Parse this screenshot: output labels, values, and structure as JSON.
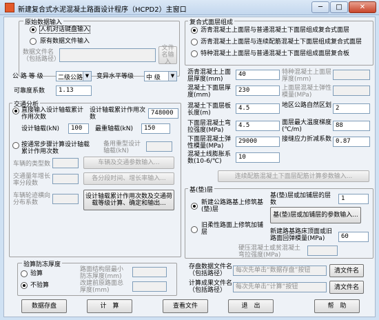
{
  "window": {
    "title": "新建复合式水泥混凝土路面设计程序（HCPD2）主窗口",
    "min": "─",
    "max": "□",
    "close": "✕"
  },
  "source": {
    "legend": "原始数据输入",
    "opt_manual": "人机对话键盘输入",
    "opt_file": "原有数据文件输入",
    "file_label": "数据文件名（包括路径）",
    "file_button": "文件名输入"
  },
  "road": {
    "grade_label": "公 路 等 级",
    "grade_value": "二级公路",
    "variability_label": "变异水平等级",
    "variability_value": "中 级",
    "reliability_label": "可靠度系数",
    "reliability_value": "1.13"
  },
  "traffic": {
    "legend": "交通分析",
    "opt_direct": "直接输入设计轴载累计作用次数",
    "cumulative_label": "设计轴载累计作用次数",
    "cumulative_value": "748000",
    "design_axle_label": "设计轴载(kN)",
    "design_axle_value": "100",
    "max_axle_label": "最重轴载(kN)",
    "max_axle_value": "150",
    "opt_calc": "按通常步骤计算设计轴载累计作用次数",
    "alt_axle_label": "备用重型设计轴载(kN)",
    "vehicle_types_label": "车辆的类型数",
    "vehicle_button": "车辆及交通参数输入...",
    "growth_label": "交通量年增长率分段数",
    "growth_button": "各分段时间、增长率输入...",
    "lateral_label": "车辆轮迹横向分布系数",
    "result_button": "设计轴载累计作用次数及交通荷载等级计算、确定和输出..."
  },
  "prevention": {
    "legend": "验算防冻厚度",
    "opt_check": "验算",
    "opt_nocheck": "不验算",
    "min_label": "路面结构层最小防冻厚度(mm)",
    "new_label": "改建前原路面总厚度(mm)"
  },
  "structure": {
    "legend": "复合式面层组成",
    "opt1": "沥青混凝土上面层与普通混凝土下面层组成复合式面层",
    "opt2": "沥青混凝土上面层与连续配筋混凝土下面层组成复合式面层",
    "opt3": "特种混凝土上面层与普通混凝土下面层组成面层复合板"
  },
  "params": {
    "asphalt_thick_label": "沥青混凝土上面层厚度(mm)",
    "asphalt_thick_value": "40",
    "special_thick_label": "特种混凝土上面层厚度(mm)",
    "concrete_thick_label": "混凝土下面层厚度(mm)",
    "concrete_thick_value": "230",
    "upper_modulus_label": "上面层混凝土弹性模量(MPa)",
    "slab_length_label": "混凝土下面层板长度(m)",
    "slab_length_value": "4.5",
    "region_label": "地区公路自然区划",
    "region_value": "2",
    "flexural_label": "下面层混凝土弯拉强度(MPa)",
    "flexural_value": "4.5",
    "gradient_label": "面层最大温度梯度(℃/m)",
    "gradient_value": "88",
    "elastic_label": "下面层混凝土弹性模量(MPa)",
    "elastic_value": "29000",
    "reduction_label": "接缝应力折减系数",
    "reduction_value": "0.87",
    "expansion_label": "混凝土线膨胀系数(10-6/℃)",
    "expansion_value": "10",
    "crcp_button": "连续配筋混凝土下面层配筋计算参数输入..."
  },
  "base": {
    "legend": "基(垫)层",
    "opt_new": "新建公路路基上修筑基(垫)层",
    "opt_old": "旧柔性路面上修筑加铺层",
    "layers_label": "基(垫)层或加铺层的层数",
    "layers_value": "1",
    "params_button": "基(垫)层或加铺层的参数输入...",
    "subgrade_label": "新建路基路床顶面或旧路面回弹模量(MPa)",
    "subgrade_value": "60",
    "hard_label": "硬压混凝土或贫混凝土弯拉强度(MPa)"
  },
  "files": {
    "save_label": "存盘数据文件名（包括路径）",
    "save_placeholder": "每次先单击“数据存盘”按钮",
    "save_clear": "清文件名",
    "result_label": "计算成果文件名（包括路径）",
    "result_placeholder": "每次先单击“计算”按钮",
    "result_clear": "清文件名"
  },
  "footer": {
    "save": "数据存盘",
    "calc": "计　算",
    "view": "查看文件",
    "exit": "退　出",
    "help": "帮　助"
  }
}
